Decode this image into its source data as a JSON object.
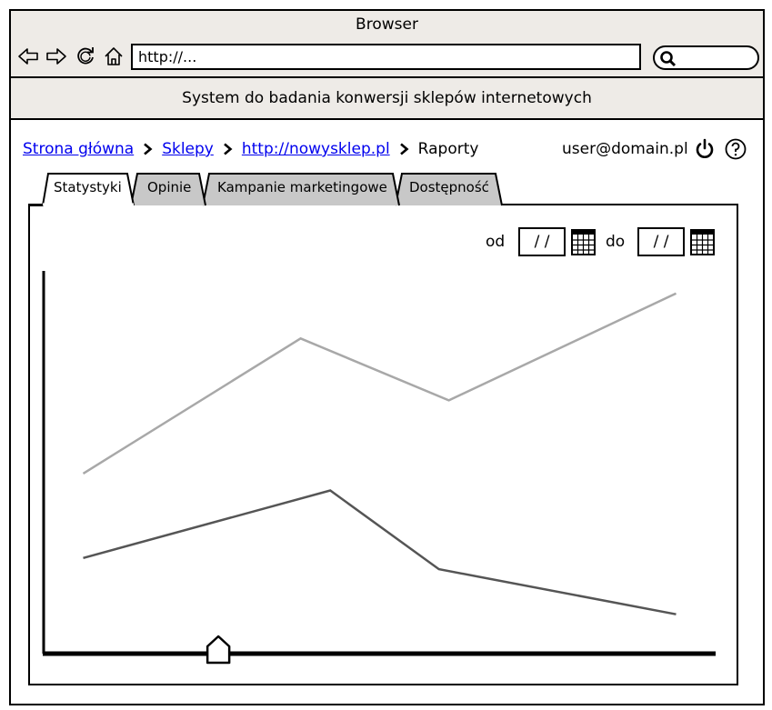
{
  "browser": {
    "title": "Browser",
    "url": "http://..."
  },
  "app": {
    "title": "System do badania konwersji sklepów internetowych"
  },
  "breadcrumb": {
    "items": [
      "Strona główna",
      "Sklepy",
      "http://nowysklep.pl"
    ],
    "current": "Raporty"
  },
  "user": {
    "email": "user@domain.pl"
  },
  "tabs": [
    {
      "label": "Statystyki",
      "active": true
    },
    {
      "label": "Opinie",
      "active": false
    },
    {
      "label": "Kampanie marketingowe",
      "active": false
    },
    {
      "label": "Dostępność",
      "active": false
    }
  ],
  "date_range": {
    "from_label": "od",
    "from_value": "/ /",
    "to_label": "do",
    "to_value": "/ /"
  },
  "colors": {
    "chrome_bg": "#eeebe7",
    "inactive_tab": "#c8c8c8",
    "link": "#0000ee",
    "series_light": "#a8a8a8",
    "series_dark": "#555555"
  },
  "chart_data": {
    "type": "line",
    "x": [
      1,
      2,
      3,
      4
    ],
    "series": [
      {
        "values": [
          32,
          56,
          45,
          64
        ],
        "color": "#a8a8a8",
        "x": [
          1,
          2.1,
          2.85,
          4
        ]
      },
      {
        "values": [
          17,
          29,
          15,
          7
        ],
        "color": "#555555",
        "x": [
          1,
          2.25,
          2.8,
          4
        ]
      }
    ],
    "ylim": [
      0,
      68
    ],
    "xlim": [
      0.8,
      4.2
    ],
    "slider_position": 0.26
  }
}
